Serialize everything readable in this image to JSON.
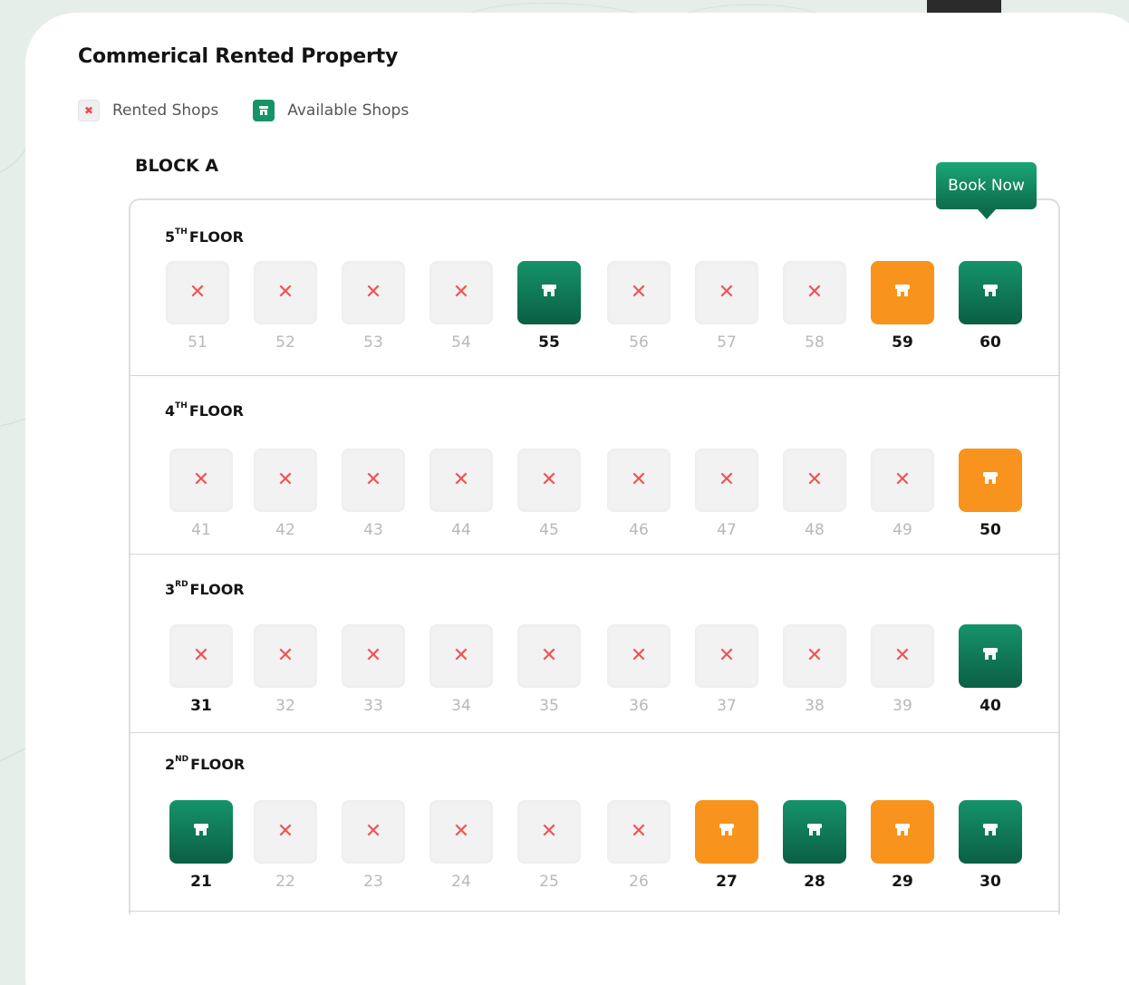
{
  "title": "Commerical Rented Property",
  "legend": {
    "rented": "Rented Shops",
    "available": "Available Shops"
  },
  "block_label": "BLOCK A",
  "book_now": "Book Now",
  "colors": {
    "available": "#159467",
    "selected": "#f8931d",
    "rented_x": "#ee5454"
  },
  "floors": [
    {
      "ordinal": "5",
      "suffix": "TH",
      "word": "FLOOR",
      "shops": [
        {
          "num": "51",
          "status": "rented"
        },
        {
          "num": "52",
          "status": "rented"
        },
        {
          "num": "53",
          "status": "rented"
        },
        {
          "num": "54",
          "status": "rented"
        },
        {
          "num": "55",
          "status": "available"
        },
        {
          "num": "56",
          "status": "rented"
        },
        {
          "num": "57",
          "status": "rented"
        },
        {
          "num": "58",
          "status": "rented"
        },
        {
          "num": "59",
          "status": "selected"
        },
        {
          "num": "60",
          "status": "available"
        }
      ]
    },
    {
      "ordinal": "4",
      "suffix": "TH",
      "word": "FLOOR",
      "shops": [
        {
          "num": "41",
          "status": "rented"
        },
        {
          "num": "42",
          "status": "rented"
        },
        {
          "num": "43",
          "status": "rented"
        },
        {
          "num": "44",
          "status": "rented"
        },
        {
          "num": "45",
          "status": "rented"
        },
        {
          "num": "46",
          "status": "rented"
        },
        {
          "num": "47",
          "status": "rented"
        },
        {
          "num": "48",
          "status": "rented"
        },
        {
          "num": "49",
          "status": "rented"
        },
        {
          "num": "50",
          "status": "selected"
        }
      ]
    },
    {
      "ordinal": "3",
      "suffix": "RD",
      "word": "FLOOR",
      "shops": [
        {
          "num": "31",
          "status": "rented",
          "strong": true
        },
        {
          "num": "32",
          "status": "rented"
        },
        {
          "num": "33",
          "status": "rented"
        },
        {
          "num": "34",
          "status": "rented"
        },
        {
          "num": "35",
          "status": "rented"
        },
        {
          "num": "36",
          "status": "rented"
        },
        {
          "num": "37",
          "status": "rented"
        },
        {
          "num": "38",
          "status": "rented"
        },
        {
          "num": "39",
          "status": "rented"
        },
        {
          "num": "40",
          "status": "available"
        }
      ]
    },
    {
      "ordinal": "2",
      "suffix": "ND",
      "word": "FLOOR",
      "shops": [
        {
          "num": "21",
          "status": "available"
        },
        {
          "num": "22",
          "status": "rented"
        },
        {
          "num": "23",
          "status": "rented"
        },
        {
          "num": "24",
          "status": "rented"
        },
        {
          "num": "25",
          "status": "rented"
        },
        {
          "num": "26",
          "status": "rented"
        },
        {
          "num": "27",
          "status": "selected"
        },
        {
          "num": "28",
          "status": "available"
        },
        {
          "num": "29",
          "status": "selected"
        },
        {
          "num": "30",
          "status": "available"
        }
      ]
    }
  ]
}
